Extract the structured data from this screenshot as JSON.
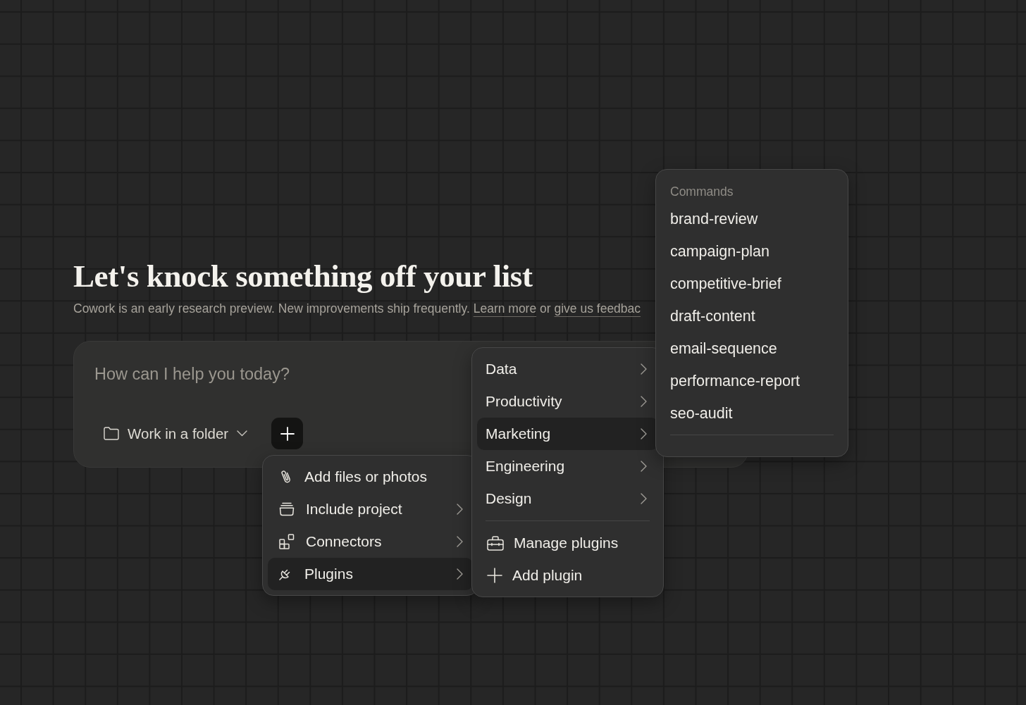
{
  "heading": {
    "title": "Let's knock something off your list",
    "intro": [
      {
        "kind": "text",
        "text": "Cowork is an early research preview. New improvements ship frequently. "
      },
      {
        "kind": "link",
        "text": "Learn more"
      },
      {
        "kind": "text",
        "text": " or "
      },
      {
        "kind": "link",
        "text": "give us feedbac"
      }
    ]
  },
  "composer": {
    "placeholder": "How can I help you today?",
    "folder_button": {
      "label": "Work in a folder"
    }
  },
  "attach_menu": {
    "items": [
      {
        "label": "Add files or photos",
        "submenu": false,
        "selected": false
      },
      {
        "label": "Include project",
        "submenu": true,
        "selected": false
      },
      {
        "label": "Connectors",
        "submenu": true,
        "selected": false
      },
      {
        "label": "Plugins",
        "submenu": true,
        "selected": true
      }
    ]
  },
  "plugins_menu": {
    "categories": [
      {
        "label": "Data",
        "selected": false
      },
      {
        "label": "Productivity",
        "selected": false
      },
      {
        "label": "Marketing",
        "selected": true
      },
      {
        "label": "Engineering",
        "selected": false
      },
      {
        "label": "Design",
        "selected": false
      }
    ],
    "actions": [
      {
        "label": "Manage plugins"
      },
      {
        "label": "Add plugin"
      }
    ]
  },
  "commands_menu": {
    "title": "Commands",
    "items": [
      {
        "label": "brand-review",
        "selected": false
      },
      {
        "label": "campaign-plan",
        "selected": false
      },
      {
        "label": "competitive-brief",
        "selected": false
      },
      {
        "label": "draft-content",
        "selected": false
      },
      {
        "label": "email-sequence",
        "selected": false
      },
      {
        "label": "performance-report",
        "selected": false
      },
      {
        "label": "seo-audit",
        "selected": false
      }
    ]
  }
}
